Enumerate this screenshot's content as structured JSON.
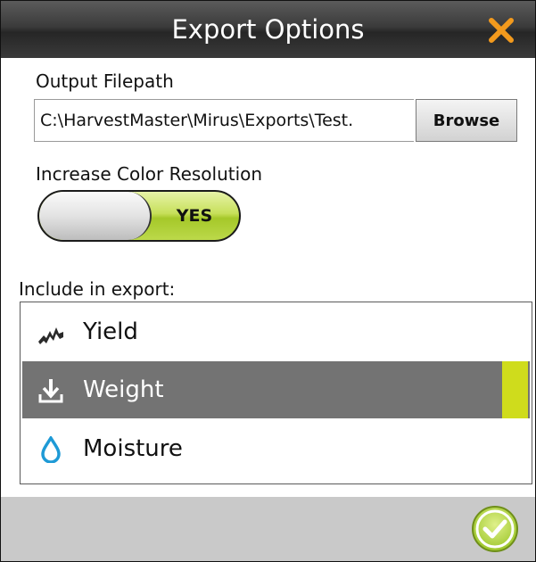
{
  "window": {
    "title": "Export Options",
    "close_icon": "close-x-icon",
    "close_color": "#f39a1d"
  },
  "output": {
    "label": "Output Filepath",
    "value": "C:\\HarvestMaster\\Mirus\\Exports\\Test.",
    "browse_label": "Browse"
  },
  "color_resolution": {
    "label": "Increase Color Resolution",
    "toggle_value": "YES",
    "toggle_color": "#b5d334"
  },
  "include": {
    "label": "Include in export:",
    "items": [
      {
        "label": "Yield",
        "icon": "yield-graph-icon",
        "selected": false
      },
      {
        "label": "Weight",
        "icon": "weight-download-icon",
        "selected": true
      },
      {
        "label": "Moisture",
        "icon": "water-drop-icon",
        "selected": false
      }
    ],
    "selected_color": "#737373",
    "indicator_color": "#cfdc1c",
    "moisture_icon_color": "#1e9ad6"
  },
  "footer": {
    "confirm_icon": "check-circle-icon",
    "confirm_color": "#a9cf2e"
  }
}
